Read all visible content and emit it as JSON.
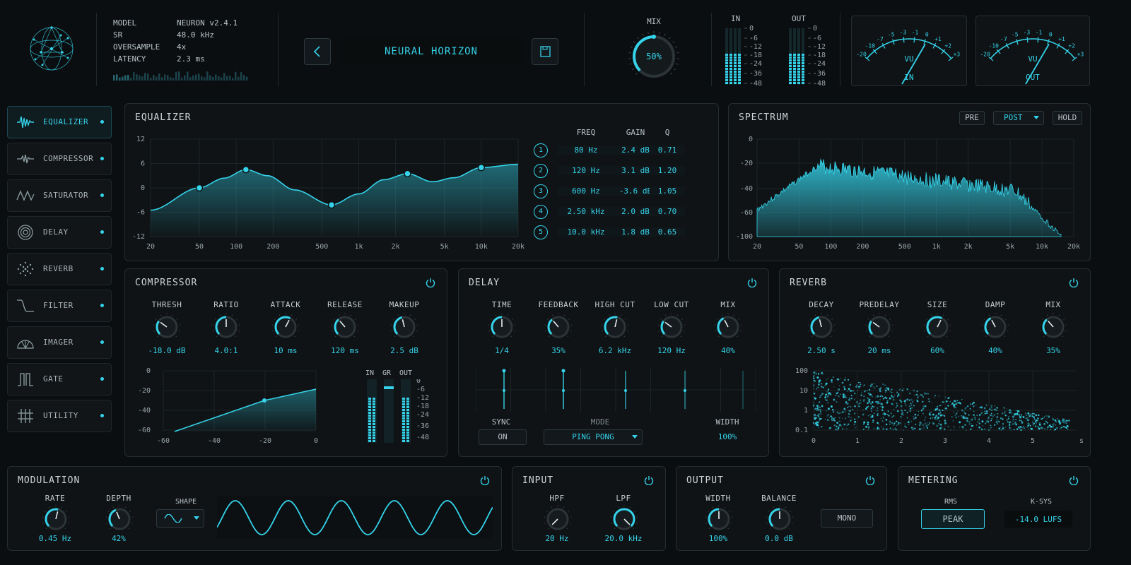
{
  "info": {
    "rows": [
      {
        "key": "MODEL",
        "value": "NEURON v2.4.1"
      },
      {
        "key": "SR",
        "value": "48.0 kHz"
      },
      {
        "key": "OVERSAMPLE",
        "value": "4x"
      },
      {
        "key": "LATENCY",
        "value": "2.3 ms"
      }
    ]
  },
  "preset": {
    "name": "NEURAL HORIZON"
  },
  "mix": {
    "label": "MIX",
    "value": "50%",
    "level": 0.5
  },
  "io_meters": {
    "in_label": "IN",
    "out_label": "OUT",
    "scale": [
      "0",
      "-6",
      "-12",
      "-18",
      "-24",
      "-36",
      "-48"
    ]
  },
  "vu": {
    "scale": [
      "-20",
      "-10",
      "-7",
      "-5",
      "-3",
      "-1",
      "0",
      "+1",
      "+2",
      "+3"
    ],
    "unit": "VU",
    "in_label": "IN",
    "out_label": "OUT"
  },
  "nav": {
    "items": [
      {
        "label": "EQUALIZER",
        "icon": "waveform-icon",
        "active": true
      },
      {
        "label": "COMPRESSOR",
        "icon": "compressor-wave-icon"
      },
      {
        "label": "SATURATOR",
        "icon": "saturator-wave-icon"
      },
      {
        "label": "DELAY",
        "icon": "concentric-circles-icon"
      },
      {
        "label": "REVERB",
        "icon": "particles-icon"
      },
      {
        "label": "FILTER",
        "icon": "filter-curve-icon"
      },
      {
        "label": "IMAGER",
        "icon": "stereo-arc-icon"
      },
      {
        "label": "GATE",
        "icon": "gate-icon"
      },
      {
        "label": "UTILITY",
        "icon": "sliders-icon"
      }
    ]
  },
  "equalizer": {
    "title": "EQUALIZER",
    "y_ticks": [
      "12",
      "6",
      "0",
      "-6",
      "-12"
    ],
    "x_ticks": [
      "20",
      "50",
      "100",
      "200",
      "500",
      "1k",
      "2k",
      "5k",
      "10k",
      "20k"
    ],
    "headers": {
      "freq": "FREQ",
      "gain": "GAIN",
      "q": "Q"
    },
    "bands": [
      {
        "num": "1",
        "freq": "80 Hz",
        "gain": "2.4 dB",
        "q": "0.71"
      },
      {
        "num": "2",
        "freq": "120 Hz",
        "gain": "3.1 dB",
        "q": "1.20"
      },
      {
        "num": "3",
        "freq": "600 Hz",
        "gain": "-3.6 dB",
        "q": "1.05"
      },
      {
        "num": "4",
        "freq": "2.50 kHz",
        "gain": "2.0 dB",
        "q": "0.70"
      },
      {
        "num": "5",
        "freq": "10.0 kHz",
        "gain": "1.8 dB",
        "q": "0.65"
      }
    ]
  },
  "spectrum": {
    "title": "SPECTRUM",
    "buttons": {
      "pre": "PRE",
      "post": "POST",
      "hold": "HOLD"
    },
    "y_ticks": [
      "0",
      "-20",
      "-40",
      "-60",
      "-100"
    ],
    "x_ticks": [
      "20",
      "50",
      "100",
      "200",
      "500",
      "1k",
      "2k",
      "5k",
      "10k",
      "20k"
    ]
  },
  "compressor": {
    "title": "COMPRESSOR",
    "knobs": [
      {
        "label": "THRESH",
        "value": "-18.0 dB",
        "level": 0.3
      },
      {
        "label": "RATIO",
        "value": "4.0:1",
        "level": 0.5
      },
      {
        "label": "ATTACK",
        "value": "10 ms",
        "level": 0.6
      },
      {
        "label": "RELEASE",
        "value": "120 ms",
        "level": 0.35
      },
      {
        "label": "MAKEUP",
        "value": "2.5 dB",
        "level": 0.45
      }
    ],
    "curve_y": [
      "0",
      "-20",
      "-40",
      "-60"
    ],
    "curve_x": [
      "-60",
      "-40",
      "-20",
      "0"
    ],
    "meter_labels": {
      "in": "IN",
      "gr": "GR",
      "out": "OUT"
    },
    "meter_scale": [
      "0",
      "-6",
      "-12",
      "-18",
      "-24",
      "-36",
      "-48"
    ]
  },
  "delay": {
    "title": "DELAY",
    "knobs": [
      {
        "label": "TIME",
        "value": "1/4",
        "level": 0.5
      },
      {
        "label": "FEEDBACK",
        "value": "35%",
        "level": 0.35
      },
      {
        "label": "HIGH CUT",
        "value": "6.2 kHz",
        "level": 0.55
      },
      {
        "label": "LOW CUT",
        "value": "120 Hz",
        "level": 0.3
      },
      {
        "label": "MIX",
        "value": "40%",
        "level": 0.4
      }
    ],
    "sync_label": "SYNC",
    "sync_value": "ON",
    "mode_label": "MODE",
    "mode_value": "PING PONG",
    "width_label": "WIDTH",
    "width_value": "100%"
  },
  "reverb": {
    "title": "REVERB",
    "knobs": [
      {
        "label": "DECAY",
        "value": "2.50 s",
        "level": 0.45
      },
      {
        "label": "PREDELAY",
        "value": "20 ms",
        "level": 0.3
      },
      {
        "label": "SIZE",
        "value": "60%",
        "level": 0.6
      },
      {
        "label": "DAMP",
        "value": "40%",
        "level": 0.4
      },
      {
        "label": "MIX",
        "value": "35%",
        "level": 0.35
      }
    ],
    "y_ticks": [
      "100",
      "10",
      "1",
      "0.1"
    ],
    "x_ticks": [
      "0",
      "1",
      "2",
      "3",
      "4",
      "5"
    ],
    "x_unit": "s"
  },
  "modulation": {
    "title": "MODULATION",
    "rate_label": "RATE",
    "rate_value": "0.45 Hz",
    "depth_label": "DEPTH",
    "depth_value": "42%",
    "shape_label": "SHAPE"
  },
  "input": {
    "title": "INPUT",
    "hpf_label": "HPF",
    "hpf_value": "20 Hz",
    "lpf_label": "LPF",
    "lpf_value": "20.0 kHz"
  },
  "output": {
    "title": "OUTPUT",
    "width_label": "WIDTH",
    "width_value": "100%",
    "balance_label": "BALANCE",
    "balance_value": "0.0 dB",
    "mono": "MONO"
  },
  "metering": {
    "title": "METERING",
    "rms": "RMS",
    "peak": "PEAK",
    "ksys": "K-SYS",
    "lufs": "-14.0 LUFS"
  },
  "colors": {
    "accent": "#35d3ea",
    "bg": "#0b0e10",
    "panel": "#0f1315",
    "border": "#262d31"
  }
}
